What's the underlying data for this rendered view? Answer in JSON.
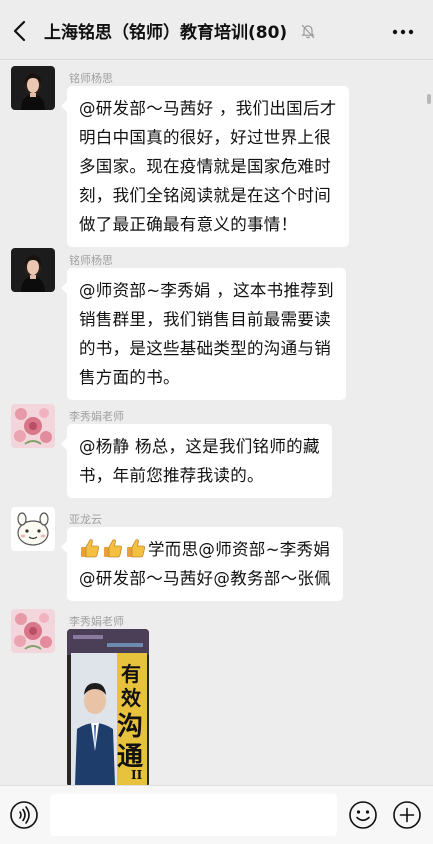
{
  "header": {
    "title": "上海铭思（铭师）教育培训(80)"
  },
  "messages": [
    {
      "sender": "铭师杨思",
      "lines": [
        "@研发部～马茜好 ，我们出国后才",
        "明白中国真的很好，好过世界上很",
        "多国家。现在疫情就是国家危难时",
        "刻，我们全铭阅读就是在这个时间",
        "做了最正确最有意义的事情！"
      ]
    },
    {
      "sender": "铭师杨思",
      "lines": [
        "@师资部~李秀娟 ，这本书推荐到",
        "销售群里，我们销售目前最需要读",
        "的书，是这些基础类型的沟通与销",
        "售方面的书。"
      ]
    },
    {
      "sender": "李秀娟老师",
      "lines": [
        "@杨静  杨总，这是我们铭师的藏",
        "书，年前您推荐我读的。"
      ]
    },
    {
      "sender": "亚龙云",
      "line1_text": "学而思@师资部~李秀娟",
      "line2_text": "@研发部～马茜好@教务部～张佩",
      "emoji": "thumbs-up"
    },
    {
      "sender": "李秀娟老师",
      "book_title_chars": [
        "有",
        "效",
        "沟",
        "通"
      ],
      "book_volume": "II"
    }
  ]
}
